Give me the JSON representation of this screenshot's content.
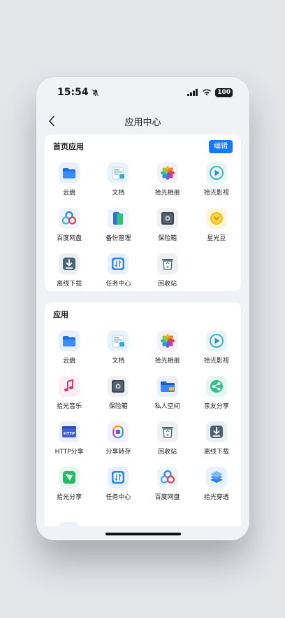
{
  "status": {
    "time": "15:54",
    "battery": "100"
  },
  "nav": {
    "title": "应用中心"
  },
  "home_apps": {
    "title": "首页应用",
    "edit_label": "编辑",
    "items": [
      {
        "label": "云盘",
        "icon": "folder-icon"
      },
      {
        "label": "文档",
        "icon": "document-icon"
      },
      {
        "label": "拾光相册",
        "icon": "photos-icon"
      },
      {
        "label": "拾光影视",
        "icon": "video-icon"
      },
      {
        "label": "百度网盘",
        "icon": "baidu-cloud-icon"
      },
      {
        "label": "备份管理",
        "icon": "backup-icon"
      },
      {
        "label": "保险箱",
        "icon": "safe-icon"
      },
      {
        "label": "星光豆",
        "icon": "star-bean-icon"
      },
      {
        "label": "离线下载",
        "icon": "offline-download-icon"
      },
      {
        "label": "任务中心",
        "icon": "task-center-icon"
      },
      {
        "label": "回收站",
        "icon": "recycle-bin-icon"
      }
    ]
  },
  "apps": {
    "title": "应用",
    "items": [
      {
        "label": "云盘",
        "icon": "folder-icon"
      },
      {
        "label": "文档",
        "icon": "document-icon"
      },
      {
        "label": "拾光相册",
        "icon": "photos-icon"
      },
      {
        "label": "拾光影视",
        "icon": "video-icon"
      },
      {
        "label": "拾光音乐",
        "icon": "music-icon"
      },
      {
        "label": "保险箱",
        "icon": "safe-icon"
      },
      {
        "label": "私人空间",
        "icon": "private-folder-icon"
      },
      {
        "label": "亲友分享",
        "icon": "share-icon"
      },
      {
        "label": "HTTP分享",
        "icon": "http-share-icon"
      },
      {
        "label": "分享转存",
        "icon": "share-transfer-icon"
      },
      {
        "label": "回收站",
        "icon": "recycle-bin-icon"
      },
      {
        "label": "离线下载",
        "icon": "offline-download-icon"
      },
      {
        "label": "拾光分享",
        "icon": "paper-plane-icon"
      },
      {
        "label": "任务中心",
        "icon": "task-center-icon"
      },
      {
        "label": "百度网盘",
        "icon": "baidu-cloud-icon"
      },
      {
        "label": "拾光穿透",
        "icon": "layers-icon"
      }
    ]
  },
  "colors": {
    "accent": "#1677ff",
    "background": "#f1f2f6",
    "card": "#ffffff"
  }
}
